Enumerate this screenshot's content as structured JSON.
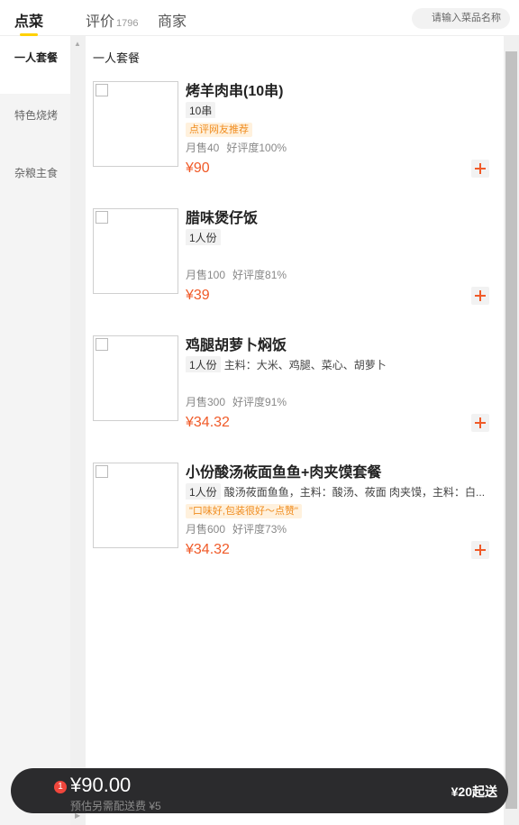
{
  "tabs": [
    {
      "label": "点菜"
    },
    {
      "label": "评价",
      "count": "1796"
    },
    {
      "label": "商家"
    }
  ],
  "search": {
    "placeholder": "请输入菜品名称"
  },
  "categories": [
    {
      "label": "一人套餐"
    },
    {
      "label": "特色烧烤"
    },
    {
      "label": "杂粮主食"
    }
  ],
  "section_title": "一人套餐",
  "items": [
    {
      "name": "烤羊肉串(10串)",
      "spec": "10串",
      "desc": "",
      "tag": "点评网友推荐",
      "sales": "月售40",
      "rating": "好评度100%",
      "price": "¥90"
    },
    {
      "name": "腊味煲仔饭",
      "spec": "1人份",
      "desc": "",
      "tag": "",
      "sales": "月售100",
      "rating": "好评度81%",
      "price": "¥39"
    },
    {
      "name": "鸡腿胡萝卜焖饭",
      "spec": "1人份",
      "desc": "主料：大米、鸡腿、菜心、胡萝卜",
      "tag": "",
      "sales": "月售300",
      "rating": "好评度91%",
      "price": "¥34.32"
    },
    {
      "name": "小份酸汤莜面鱼鱼+肉夹馍套餐",
      "spec": "1人份",
      "desc": "酸汤莜面鱼鱼，主料：酸汤、莜面 肉夹馍，主料：白...",
      "tag": "\"口味好,包装很好～点赞\"",
      "sales": "月售600",
      "rating": "好评度73%",
      "price": "¥34.32"
    }
  ],
  "cart": {
    "badge": "1",
    "total": "¥90.00",
    "delivery_fee": "预估另需配送费 ¥5",
    "min_order": "¥20起送"
  },
  "icons": {
    "add": "plus-icon",
    "search": "search-icon",
    "scroll_up": "triangle-up-icon",
    "scroll_right": "triangle-right-icon"
  },
  "colors": {
    "accent": "#ffd100",
    "price": "#f05a28",
    "tag_text": "#f08c1e",
    "cart_bg": "#2b2b2d",
    "badge": "#f0463c"
  }
}
